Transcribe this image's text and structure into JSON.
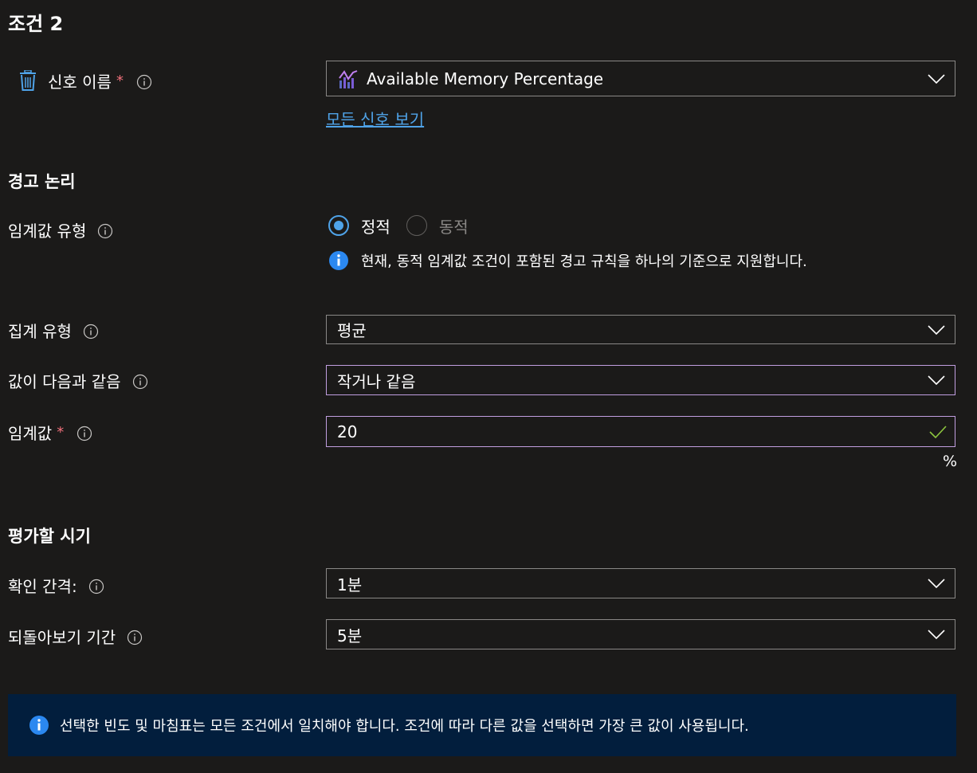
{
  "condition": {
    "title": "조건 2"
  },
  "signal": {
    "label": "신호 이름",
    "required_mark": "*",
    "value": "Available Memory Percentage",
    "see_all_link": "모든 신호 보기"
  },
  "alert_logic": {
    "heading": "경고 논리",
    "threshold_type": {
      "label": "임계값 유형",
      "options": [
        {
          "label": "정적",
          "selected": true
        },
        {
          "label": "동적",
          "selected": false
        }
      ],
      "info_text": "현재, 동적 임계값 조건이 포함된 경고 규칙을 하나의 기준으로 지원합니다."
    },
    "aggregation": {
      "label": "집계 유형",
      "value": "평균"
    },
    "operator": {
      "label": "값이 다음과 같음",
      "value": "작거나 같음"
    },
    "threshold": {
      "label": "임계값",
      "required_mark": "*",
      "value": "20",
      "unit": "%"
    }
  },
  "evaluation": {
    "heading": "평가할 시기",
    "check_interval": {
      "label": "확인 간격:",
      "value": "1분"
    },
    "lookback": {
      "label": "되돌아보기 기간",
      "value": "5분"
    }
  },
  "banner": {
    "text": "선택한 빈도 및 마침표는 모든 조건에서 일치해야 합니다. 조건에 따라 다른 값을 선택하면 가장 큰 값이 사용됩니다."
  },
  "colors": {
    "background": "#1b1a19",
    "accent": "#4fa3e8",
    "focus_border": "#c19fe0",
    "required": "#f1707b",
    "valid_check": "#8dc63f",
    "banner_bg": "#021e3d"
  }
}
